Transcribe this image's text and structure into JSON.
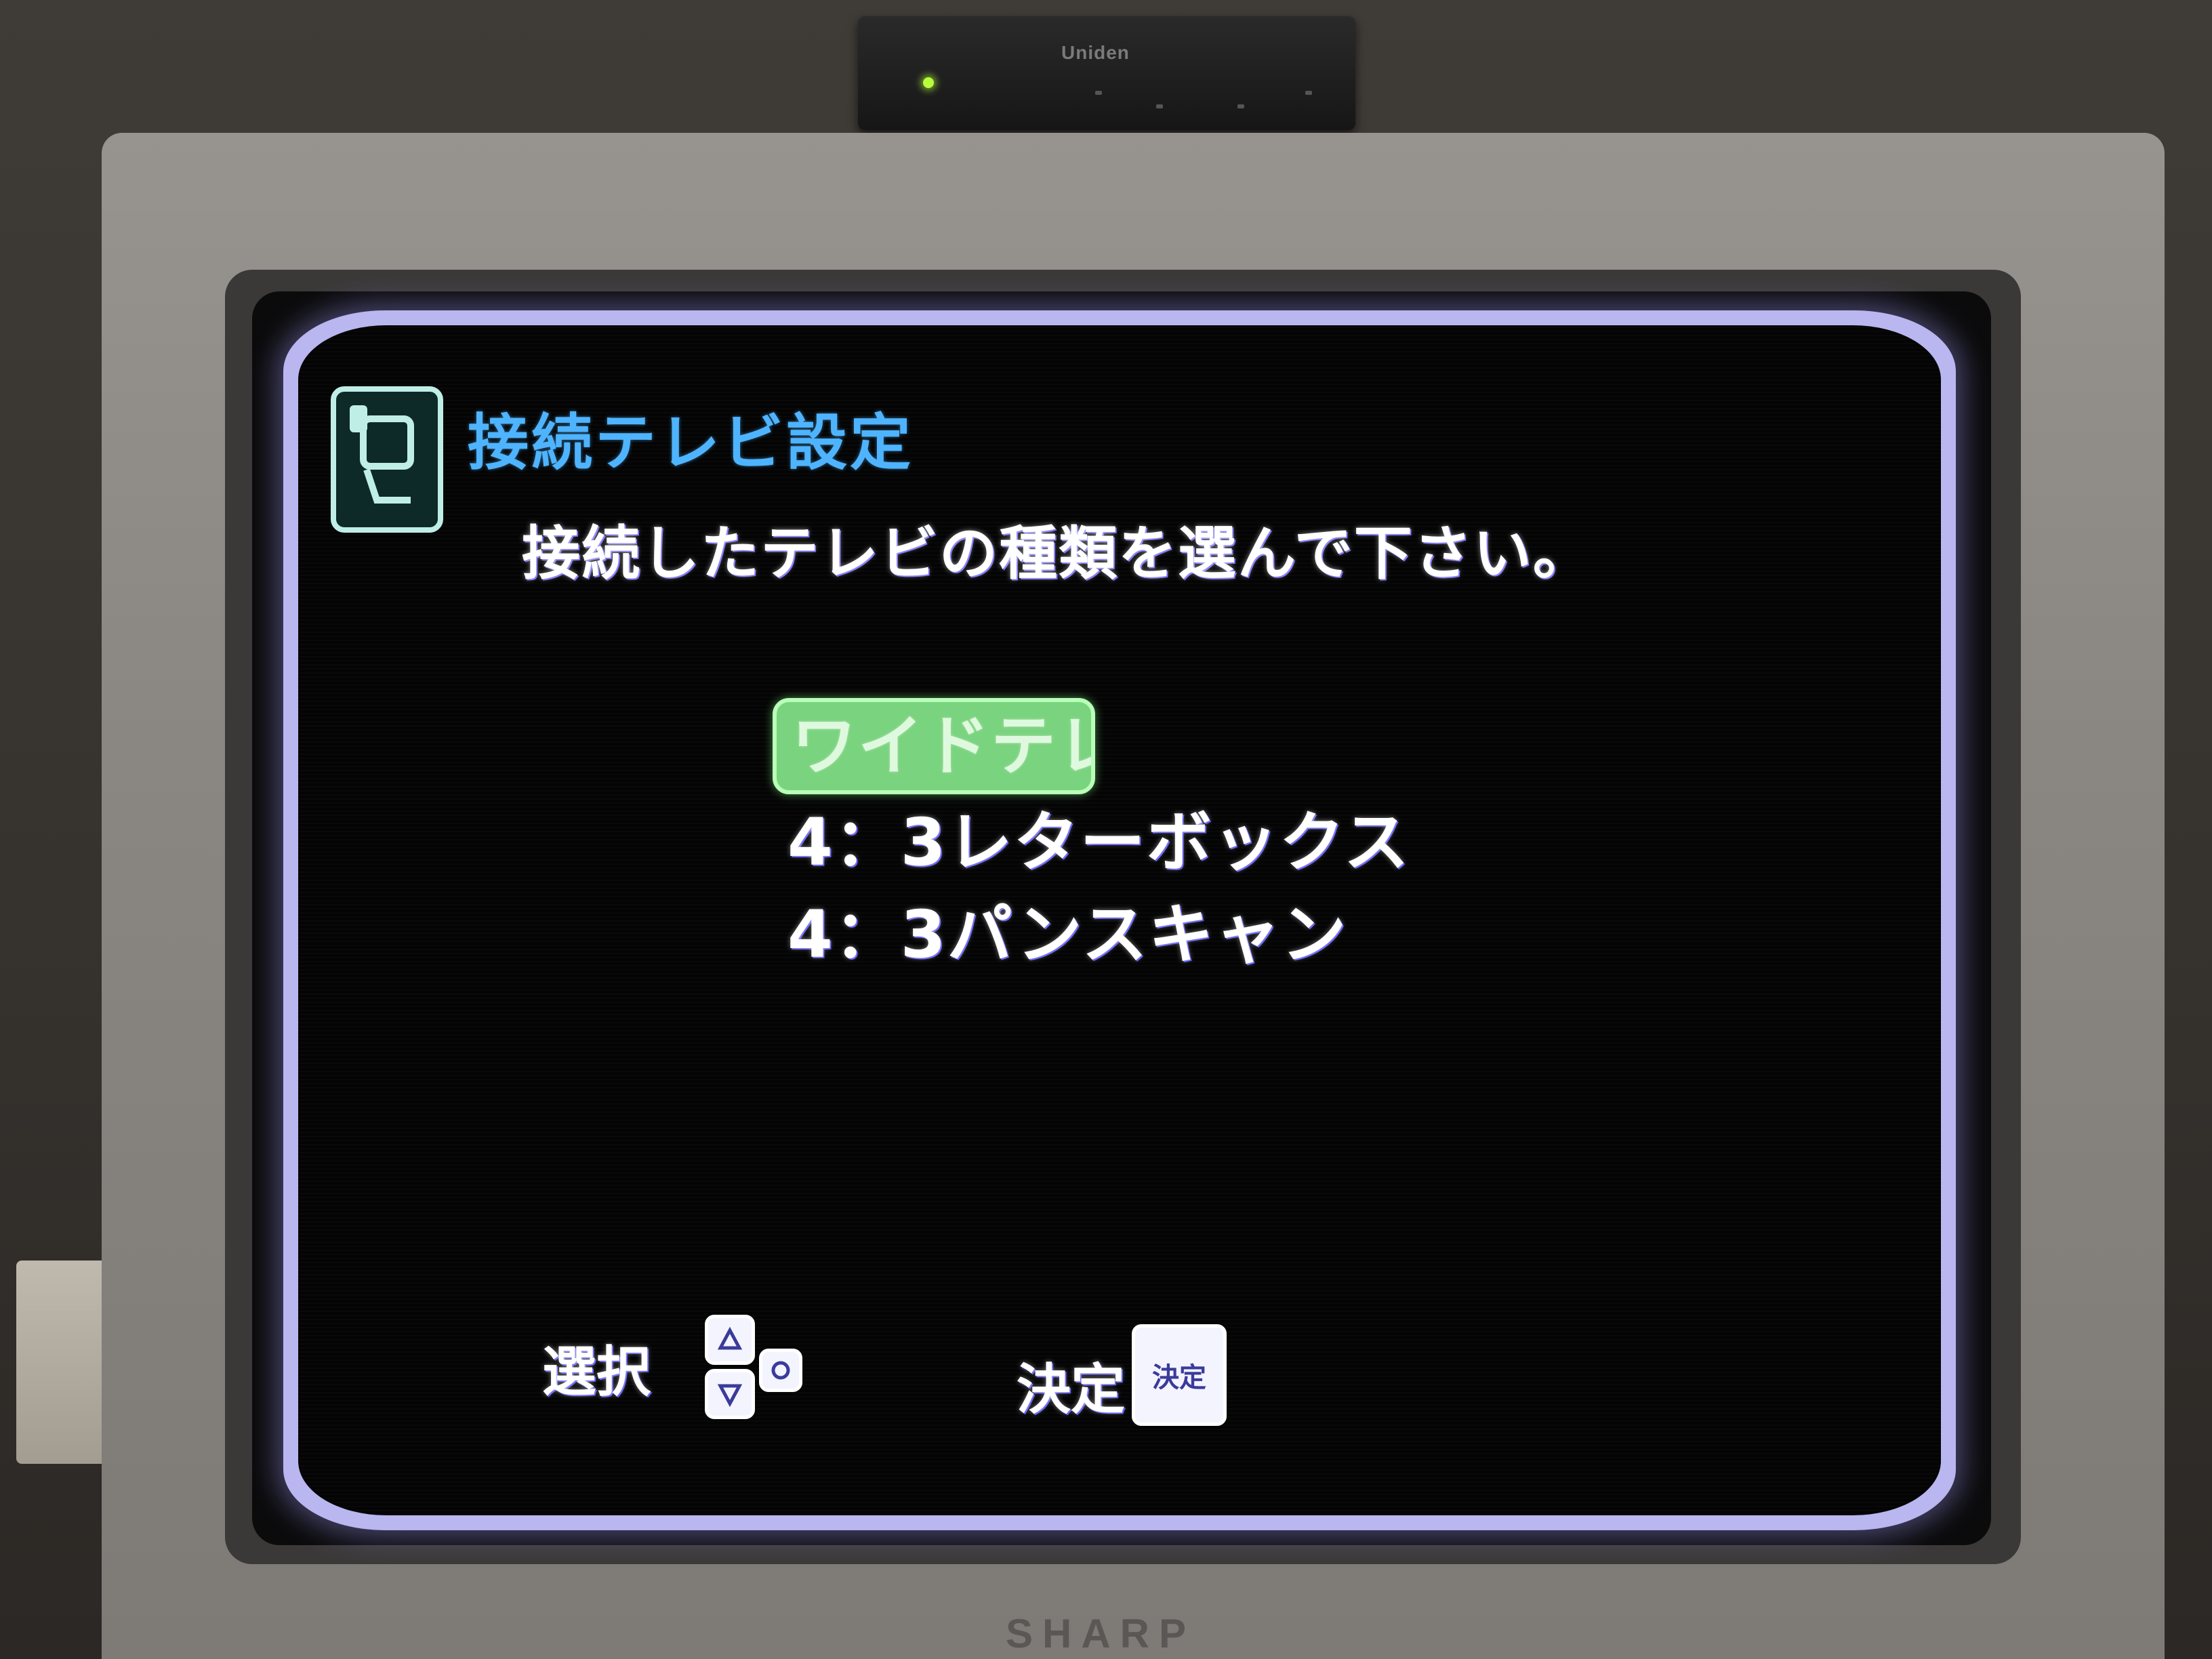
{
  "tuner": {
    "brand": "Uniden"
  },
  "tv": {
    "brand": "SHARP"
  },
  "osd": {
    "title": "接続テレビ設定",
    "instruction": "接続したテレビの種類を選んで下さい。",
    "options": [
      {
        "label": "ワイドテレビ",
        "selected": true
      },
      {
        "label": "4：3レターボックス",
        "selected": false
      },
      {
        "label": "4：3パンスキャン",
        "selected": false
      }
    ],
    "hints": {
      "select_label": "選択",
      "confirm_label": "決定",
      "confirm_key": "決定"
    },
    "colors": {
      "title": "#4fb4ff",
      "highlight": "#7ad37e",
      "screen_border": "#b9b6f0"
    }
  }
}
